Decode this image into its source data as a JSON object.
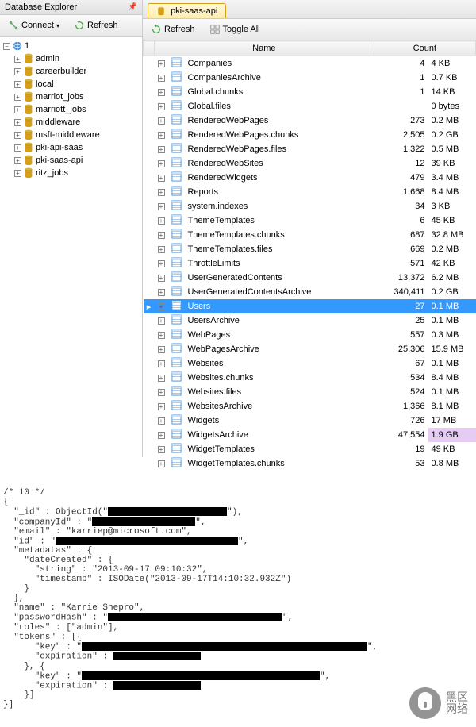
{
  "explorer": {
    "title": "Database Explorer",
    "connect_label": "Connect",
    "refresh_label": "Refresh",
    "root_label": "1",
    "databases": [
      "admin",
      "careerbuilder",
      "local",
      "marriot_jobs",
      "marriott_jobs",
      "middleware",
      "msft-middleware",
      "pki-api-saas",
      "pki-saas-api",
      "ritz_jobs"
    ]
  },
  "tab": {
    "label": "pki-saas-api"
  },
  "main_toolbar": {
    "refresh_label": "Refresh",
    "toggle_label": "Toggle All"
  },
  "columns": {
    "name": "Name",
    "count": "Count"
  },
  "collections": [
    {
      "name": "Companies",
      "count": "4",
      "size": "4 KB"
    },
    {
      "name": "CompaniesArchive",
      "count": "1",
      "size": "0.7 KB"
    },
    {
      "name": "Global.chunks",
      "count": "1",
      "size": "14 KB"
    },
    {
      "name": "Global.files",
      "count": "",
      "size": "0 bytes"
    },
    {
      "name": "RenderedWebPages",
      "count": "273",
      "size": "0.2 MB"
    },
    {
      "name": "RenderedWebPages.chunks",
      "count": "2,505",
      "size": "0.2 GB"
    },
    {
      "name": "RenderedWebPages.files",
      "count": "1,322",
      "size": "0.5 MB"
    },
    {
      "name": "RenderedWebSites",
      "count": "12",
      "size": "39 KB"
    },
    {
      "name": "RenderedWidgets",
      "count": "479",
      "size": "3.4 MB"
    },
    {
      "name": "Reports",
      "count": "1,668",
      "size": "8.4 MB"
    },
    {
      "name": "system.indexes",
      "count": "34",
      "size": "3 KB"
    },
    {
      "name": "ThemeTemplates",
      "count": "6",
      "size": "45 KB"
    },
    {
      "name": "ThemeTemplates.chunks",
      "count": "687",
      "size": "32.8 MB"
    },
    {
      "name": "ThemeTemplates.files",
      "count": "669",
      "size": "0.2 MB"
    },
    {
      "name": "ThrottleLimits",
      "count": "571",
      "size": "42 KB"
    },
    {
      "name": "UserGeneratedContents",
      "count": "13,372",
      "size": "6.2 MB"
    },
    {
      "name": "UserGeneratedContentsArchive",
      "count": "340,411",
      "size": "0.2 GB"
    },
    {
      "name": "Users",
      "count": "27",
      "size": "0.1 MB",
      "selected": true
    },
    {
      "name": "UsersArchive",
      "count": "25",
      "size": "0.1 MB"
    },
    {
      "name": "WebPages",
      "count": "557",
      "size": "0.3 MB"
    },
    {
      "name": "WebPagesArchive",
      "count": "25,306",
      "size": "15.9 MB"
    },
    {
      "name": "Websites",
      "count": "67",
      "size": "0.1 MB"
    },
    {
      "name": "Websites.chunks",
      "count": "534",
      "size": "8.4 MB"
    },
    {
      "name": "Websites.files",
      "count": "524",
      "size": "0.1 MB"
    },
    {
      "name": "WebsitesArchive",
      "count": "1,366",
      "size": "8.1 MB"
    },
    {
      "name": "Widgets",
      "count": "726",
      "size": "17 MB"
    },
    {
      "name": "WidgetsArchive",
      "count": "47,554",
      "size": "1.9 GB",
      "highlighted": true
    },
    {
      "name": "WidgetTemplates",
      "count": "19",
      "size": "49 KB"
    },
    {
      "name": "WidgetTemplates.chunks",
      "count": "53",
      "size": "0.8 MB"
    }
  ],
  "code": {
    "comment": "/* 10 */",
    "obj_open": "{",
    "id_label": "  \"_id\" : ObjectId(\"",
    "id_close": "\"),",
    "companyId_label": "  \"companyId\" : \"",
    "companyId_close": "\",",
    "email_full": "  \"email\" : \"karriep@microsoft.com\",",
    "id2_label": "  \"id\" : \"",
    "id2_close": "\",",
    "metadatas": "  \"metadatas\" : {",
    "dateCreated": "    \"dateCreated\" : {",
    "string": "      \"string\" : \"2013-09-17 09:10:32\",",
    "timestamp": "      \"timestamp\" : ISODate(\"2013-09-17T14:10:32.932Z\")",
    "brace_close1": "    }",
    "brace_close2": "  },",
    "name_line": "  \"name\" : \"Karrie Shepro\",",
    "pwhash_label": "  \"passwordHash\" : \"",
    "pwhash_close": "\",",
    "roles": "  \"roles\" : [\"admin\"],",
    "tokens": "  \"tokens\" : [{",
    "key_label": "      \"key\" : \"",
    "key_close": "\",",
    "exp_label": "      \"expiration\" : ",
    "brace_sep": "    }, {",
    "brace_close3": "    }]",
    "brace_close4": "}]"
  },
  "watermark": {
    "line1": "黑区",
    "line2": "网络"
  }
}
